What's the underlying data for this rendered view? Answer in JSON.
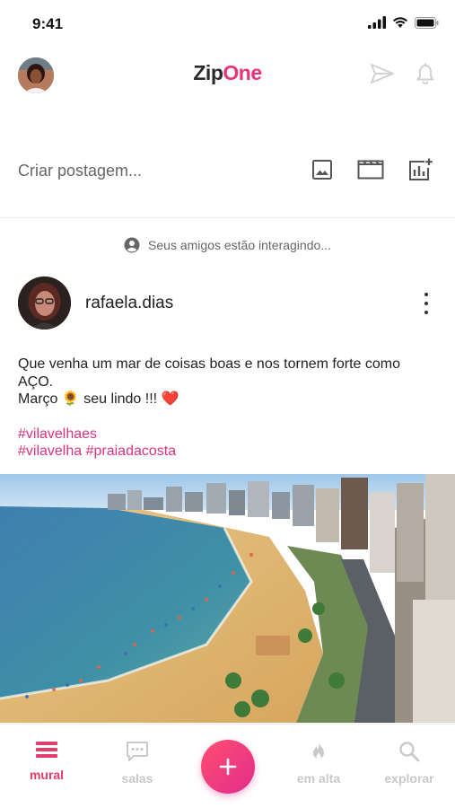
{
  "status_bar": {
    "time": "9:41"
  },
  "header": {
    "brand_zip": "Zip",
    "brand_one": "One",
    "icons": [
      "avatar",
      "send-icon",
      "bell-icon"
    ]
  },
  "create_post": {
    "placeholder": "Criar postagem...",
    "actions": [
      "image-icon",
      "video-icon",
      "chart-add-icon"
    ]
  },
  "activity": {
    "text": "Seus amigos estão interagindo..."
  },
  "post": {
    "username": "rafaela.dias",
    "text_line1": "Que venha um mar de coisas boas e nos tornem forte como AÇO.",
    "text_line2": "Março 🌻 seu lindo !!! ❤️",
    "hashtag_line1": "#vilavelhaes",
    "hashtag_line2": "#vilavelha #praiadacosta"
  },
  "bottom_nav": {
    "items": [
      {
        "label": "mural",
        "icon": "mural-icon",
        "active": true
      },
      {
        "label": "salas",
        "icon": "chat-icon",
        "active": false
      },
      {
        "label": "",
        "icon": "plus-icon",
        "active": false
      },
      {
        "label": "em alta",
        "icon": "flame-icon",
        "active": false
      },
      {
        "label": "explorar",
        "icon": "search-icon",
        "active": false
      }
    ]
  },
  "colors": {
    "accent": "#e8337a",
    "hashtag": "#d6357f",
    "nav_active": "#e23e6b",
    "nav_inactive": "#c9c9c9"
  }
}
